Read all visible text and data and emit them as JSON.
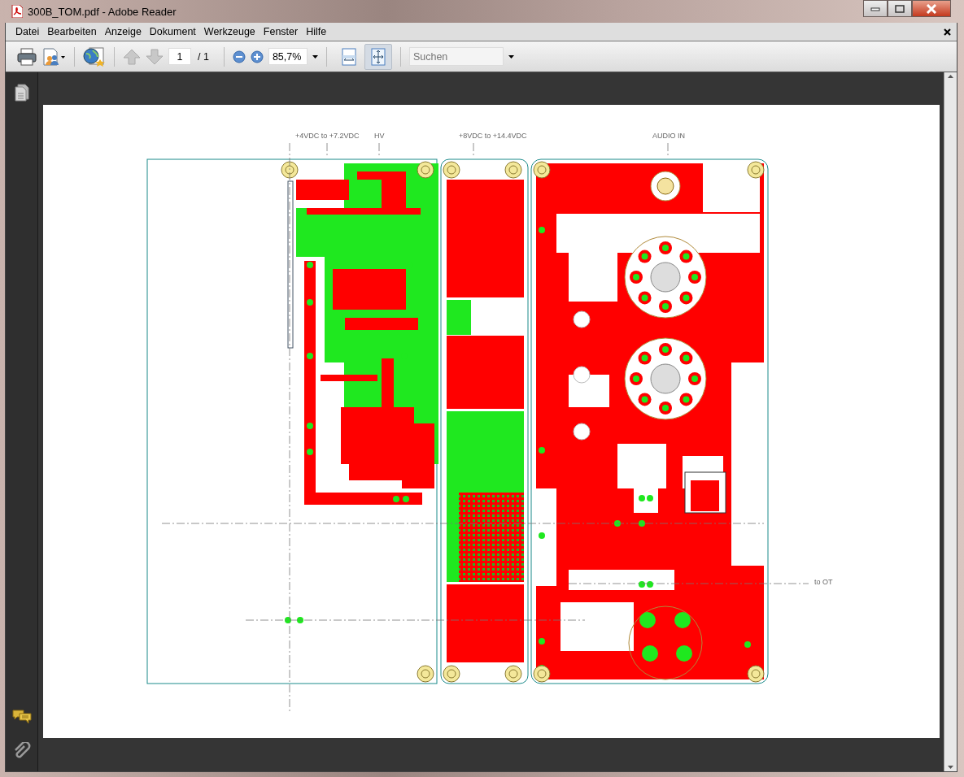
{
  "window": {
    "title": "300B_TOM.pdf - Adobe Reader"
  },
  "menu": [
    "Datei",
    "Bearbeiten",
    "Anzeige",
    "Dokument",
    "Werkzeuge",
    "Fenster",
    "Hilfe"
  ],
  "toolbar": {
    "page_number": "1",
    "page_count": "/ 1",
    "zoom": "85,7%",
    "search": {
      "placeholder": "Suchen"
    },
    "view_modes": [
      {
        "kind": "fit-width",
        "selected": false
      },
      {
        "kind": "fit-page",
        "selected": true
      }
    ]
  },
  "document": {
    "labels": [
      {
        "text": "+4VDC to +7.2VDC"
      },
      {
        "text": "HV"
      },
      {
        "text": "+8VDC to +14.4VDC"
      },
      {
        "text": "AUDIO IN"
      },
      {
        "text": "to OT"
      }
    ]
  }
}
